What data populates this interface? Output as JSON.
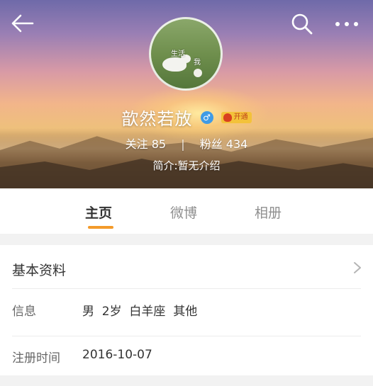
{
  "header": {
    "username": "歆然若放",
    "gender_symbol": "♂",
    "vip_label": "开通",
    "avatar_tags": [
      "生活",
      "我"
    ],
    "stats": {
      "following_label": "关注",
      "following_count": "85",
      "separator": "|",
      "followers_label": "粉丝",
      "followers_count": "434"
    },
    "bio": "简介:暂无介绍"
  },
  "tabs": [
    {
      "label": "主页",
      "active": true
    },
    {
      "label": "微博",
      "active": false
    },
    {
      "label": "相册",
      "active": false
    }
  ],
  "profile_card": {
    "title": "基本资料",
    "rows": [
      {
        "label": "信息",
        "value": "男  2岁  白羊座  其他"
      },
      {
        "label": "注册时间",
        "value": "2016-10-07"
      }
    ]
  },
  "icons": {
    "back": "back-arrow-icon",
    "search": "search-icon",
    "more": "more-icon",
    "chevron": "chevron-right-icon"
  },
  "colors": {
    "accent": "#f39a2a",
    "gender_badge": "#3f9be6",
    "vip_badge": "#f3c23a"
  }
}
